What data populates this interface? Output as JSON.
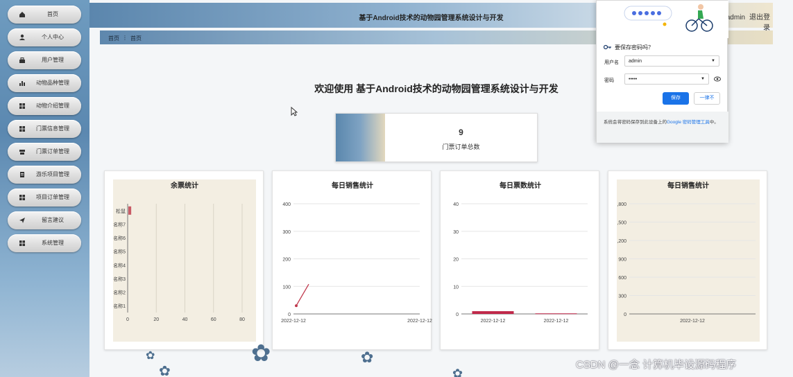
{
  "app": {
    "title": "基于Android技术的动物园管理系统设计与开发",
    "user_name": "admin",
    "logout_label": "退出登录"
  },
  "sidebar": {
    "items": [
      {
        "label": "首页",
        "icon": "home-icon"
      },
      {
        "label": "个人中心",
        "icon": "user-icon"
      },
      {
        "label": "用户管理",
        "icon": "users-icon"
      },
      {
        "label": "动物品种管理",
        "icon": "bar-chart-icon"
      },
      {
        "label": "动物介绍管理",
        "icon": "grid-icon"
      },
      {
        "label": "门票信息管理",
        "icon": "grid-icon"
      },
      {
        "label": "门票订单管理",
        "icon": "stack-icon"
      },
      {
        "label": "游乐项目管理",
        "icon": "document-icon"
      },
      {
        "label": "项目订单管理",
        "icon": "grid-icon"
      },
      {
        "label": "留言建议",
        "icon": "send-icon"
      },
      {
        "label": "系统管理",
        "icon": "grid-icon"
      }
    ]
  },
  "breadcrumb": {
    "home": "首页",
    "separator": "⋮",
    "current": "首页"
  },
  "main": {
    "welcome": "欢迎使用 基于Android技术的动物园管理系统设计与开发",
    "stat": {
      "value": "9",
      "label": "门票订单总数"
    }
  },
  "chart_data": [
    {
      "type": "bar",
      "orientation": "horizontal",
      "title": "余票统计",
      "categories": [
        "名称1",
        "名称2",
        "名称3",
        "名称4",
        "名称5",
        "名称6",
        "名称7",
        "松鼠"
      ],
      "values": [
        0,
        0,
        0,
        0,
        0,
        0,
        0,
        2
      ],
      "xticks": [
        "0",
        "20",
        "40",
        "60",
        "80"
      ],
      "xlim": [
        0,
        80
      ],
      "color": "#c95b66",
      "background": "#f3eee2"
    },
    {
      "type": "line",
      "title": "每日销售统计",
      "x": [
        "2022-12-12",
        "2022-12-12"
      ],
      "values": [
        30,
        108
      ],
      "yticks": [
        "0",
        "100",
        "200",
        "300",
        "400"
      ],
      "ylim": [
        0,
        400
      ],
      "color": "#c0394d"
    },
    {
      "type": "bar",
      "title": "每日票数统计",
      "categories": [
        "2022-12-12",
        "2022-12-12"
      ],
      "values": [
        1,
        0.2
      ],
      "yticks": [
        "0",
        "10",
        "20",
        "30",
        "40"
      ],
      "ylim": [
        0,
        40
      ],
      "color": "#c0294a"
    },
    {
      "type": "line",
      "title": "每日销售统计",
      "x": [
        "2022-12-12"
      ],
      "values": [
        0
      ],
      "yticks": [
        "0",
        "300",
        "600",
        "900",
        ",200",
        ",500",
        ",800"
      ],
      "ylim": [
        0,
        1800
      ],
      "color": "#c0394d",
      "background": "#f3eee2"
    }
  ],
  "password_popup": {
    "question": "要保存密码吗？",
    "username_label": "用户名",
    "username_value": "admin",
    "password_label": "密码",
    "password_value": "•••••",
    "save_label": "保存",
    "never_label": "一律不",
    "footer_text": "系统会将密码保存到此设备上的",
    "footer_link": "Google 密码管理工具",
    "footer_end": "中。"
  },
  "watermark": "CSDN @一念 计算机毕设源码程序"
}
